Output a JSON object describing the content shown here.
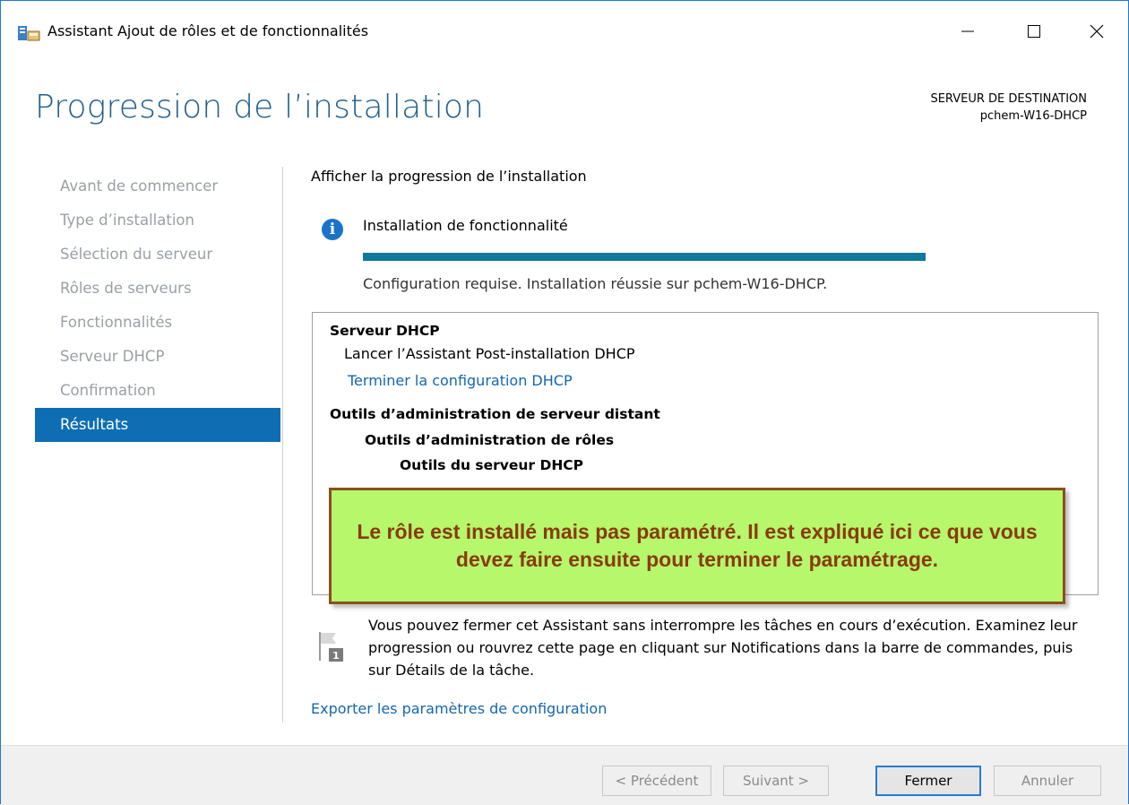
{
  "window": {
    "title": "Assistant Ajout de rôles et de fonctionnalités"
  },
  "header": {
    "page_title": "Progression de l’installation",
    "dest_label": "SERVEUR DE DESTINATION",
    "dest_server": "pchem-W16-DHCP"
  },
  "nav": {
    "items": [
      {
        "label": "Avant de commencer",
        "active": false
      },
      {
        "label": "Type d’installation",
        "active": false
      },
      {
        "label": "Sélection du serveur",
        "active": false
      },
      {
        "label": "Rôles de serveurs",
        "active": false
      },
      {
        "label": "Fonctionnalités",
        "active": false
      },
      {
        "label": "Serveur DHCP",
        "active": false
      },
      {
        "label": "Confirmation",
        "active": false
      },
      {
        "label": "Résultats",
        "active": true
      }
    ]
  },
  "content": {
    "section_title": "Afficher la progression de l’installation",
    "install_label": "Installation de fonctionnalité",
    "progress_percent": 100,
    "status": "Configuration requise. Installation réussie sur pchem-W16-DHCP.",
    "results": {
      "dhcp_heading": "Serveur DHCP",
      "dhcp_post": "Lancer l’Assistant Post-installation DHCP",
      "dhcp_link": "Terminer la configuration DHCP",
      "rsat_heading": "Outils d’administration de serveur distant",
      "rsat_roles": "Outils d’administration de rôles",
      "rsat_dhcp": "Outils du serveur DHCP"
    },
    "callout": "Le rôle est installé mais pas paramétré. Il est expliqué ici ce que vous devez faire ensuite pour terminer le paramétrage.",
    "note": "Vous pouvez fermer cet Assistant sans interrompre les tâches en cours d’exécution. Examinez leur progression ou rouvrez cette page en cliquant sur Notifications dans la barre de commandes, puis sur Détails de la tâche.",
    "flag_badge": "1",
    "export_link": "Exporter les paramètres de configuration"
  },
  "footer": {
    "prev": "< Précédent",
    "next": "Suivant >",
    "close": "Fermer",
    "cancel": "Annuler"
  },
  "colors": {
    "accent": "#0f6eb3",
    "progress": "#0f7a9a",
    "callout_bg": "#b6f76b",
    "callout_text": "#8a3a0b"
  }
}
